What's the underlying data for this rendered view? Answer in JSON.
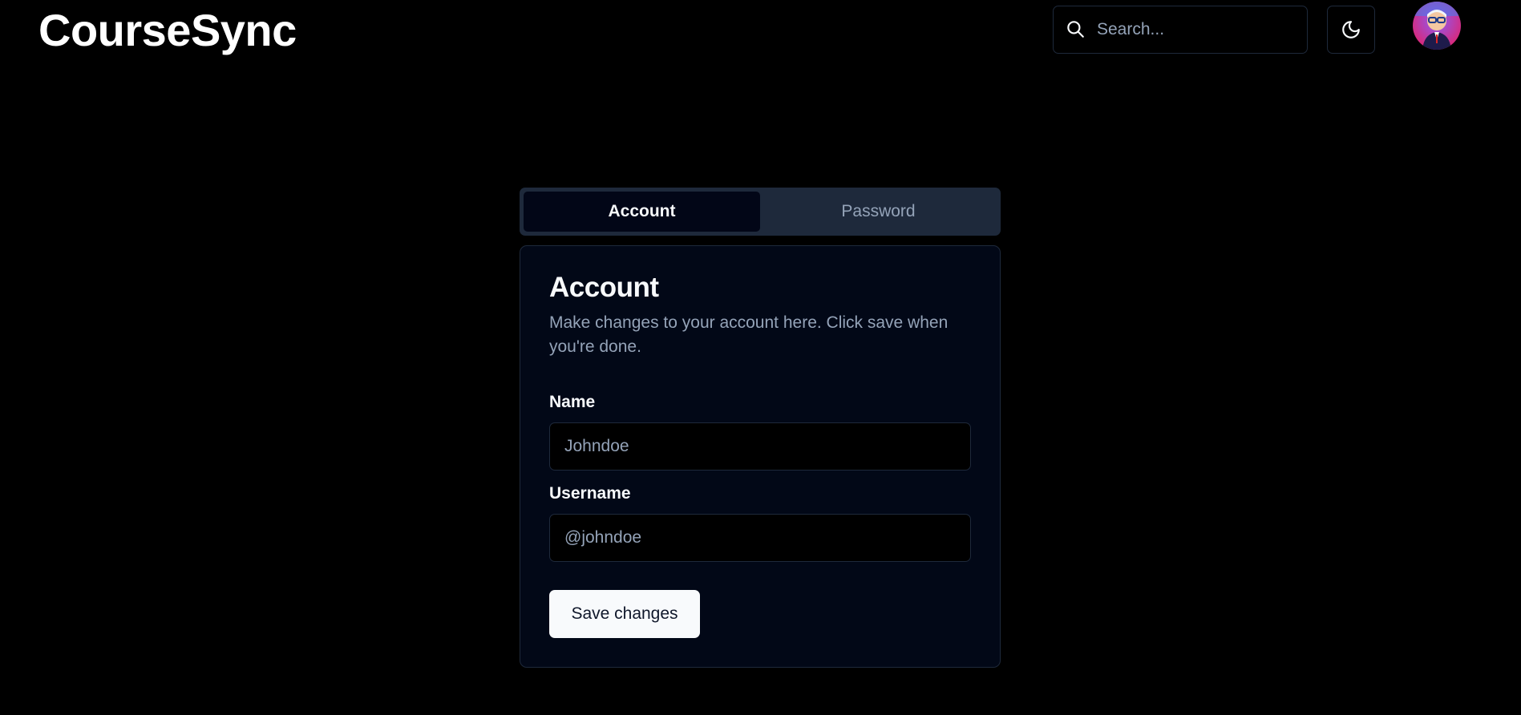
{
  "app": {
    "title": "CourseSync"
  },
  "header": {
    "search": {
      "placeholder": "Search...",
      "icon": "search-icon"
    },
    "theme_toggle": {
      "icon": "moon-icon"
    },
    "avatar": {
      "icon": "user-avatar"
    }
  },
  "tabs": [
    {
      "label": "Account",
      "active": true
    },
    {
      "label": "Password",
      "active": false
    }
  ],
  "card": {
    "title": "Account",
    "description": "Make changes to your account here. Click save when you're done.",
    "fields": {
      "name": {
        "label": "Name",
        "placeholder": "Johndoe"
      },
      "username": {
        "label": "Username",
        "placeholder": "@johndoe"
      }
    },
    "save_label": "Save changes"
  },
  "colors": {
    "background": "#000000",
    "card_bg": "#020817",
    "border": "#1e293b",
    "muted_text": "#94a3b8",
    "primary_text": "#f8fafc",
    "button_bg": "#f8fafc"
  }
}
